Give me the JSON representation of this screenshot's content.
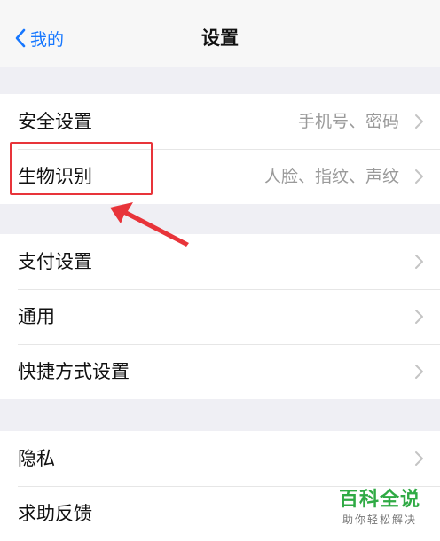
{
  "nav": {
    "back_label": "我的",
    "title": "设置"
  },
  "groups": [
    {
      "rows": [
        {
          "label": "安全设置",
          "value": "手机号、密码"
        },
        {
          "label": "生物识别",
          "value": "人脸、指纹、声纹"
        }
      ]
    },
    {
      "rows": [
        {
          "label": "支付设置",
          "value": ""
        },
        {
          "label": "通用",
          "value": ""
        },
        {
          "label": "快捷方式设置",
          "value": ""
        }
      ]
    },
    {
      "rows": [
        {
          "label": "隐私",
          "value": ""
        },
        {
          "label": "求助反馈",
          "value": ""
        }
      ]
    }
  ],
  "watermark": {
    "title": "百科全说",
    "subtitle": "助你轻松解决"
  },
  "colors": {
    "accent": "#1677ff",
    "annotation": "#e8343a",
    "watermark": "#2faa44"
  }
}
